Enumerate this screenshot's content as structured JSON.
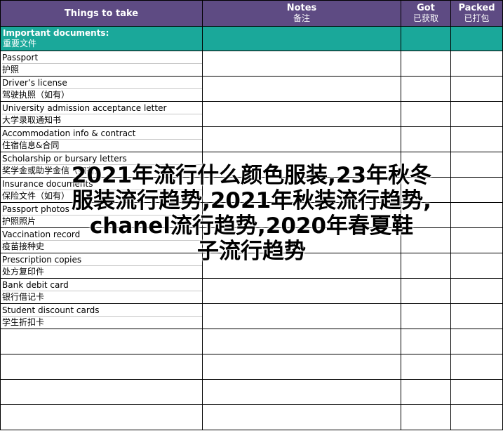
{
  "header": {
    "things": "Things to take",
    "notes_en": "Notes",
    "notes_zh": "备注",
    "got_en": "Got",
    "got_zh": "已获取",
    "packed_en": "Packed",
    "packed_zh": "已打包"
  },
  "section": {
    "title_en": "Important documents:",
    "title_zh": "重要文件"
  },
  "items": [
    {
      "en": "Passport",
      "zh": "护照"
    },
    {
      "en": "Driver’s license",
      "zh": "驾驶执照（如有）"
    },
    {
      "en": "University admission acceptance letter",
      "zh": "大学录取通知书"
    },
    {
      "en": "Accommodation info & contract",
      "zh": "住宿信息&合同"
    },
    {
      "en": "Scholarship or bursary letters",
      "zh": "奖学金或助学金信（如有）"
    },
    {
      "en": "Insurance documents",
      "zh": "保险文件（如有）"
    },
    {
      "en": "Passport photos",
      "zh": "护照照片"
    },
    {
      "en": "Vaccination record",
      "zh": "疫苗接种史"
    },
    {
      "en": "Prescription copies",
      "zh": "处方复印件"
    },
    {
      "en": "Bank debit card",
      "zh": "银行借记卡"
    },
    {
      "en": "Student discount cards",
      "zh": "学生折扣卡"
    }
  ],
  "watermark": {
    "line1": "2021年流行什么颜色服装,23年秋冬",
    "line2": "服装流行趋势,2021年秋装流行趋势,",
    "line3": "chanel流行趋势,2020年春夏鞋",
    "line4": "子流行趋势"
  },
  "colors": {
    "header_bg": "#5e4b83",
    "section_bg": "#1aa89a"
  }
}
